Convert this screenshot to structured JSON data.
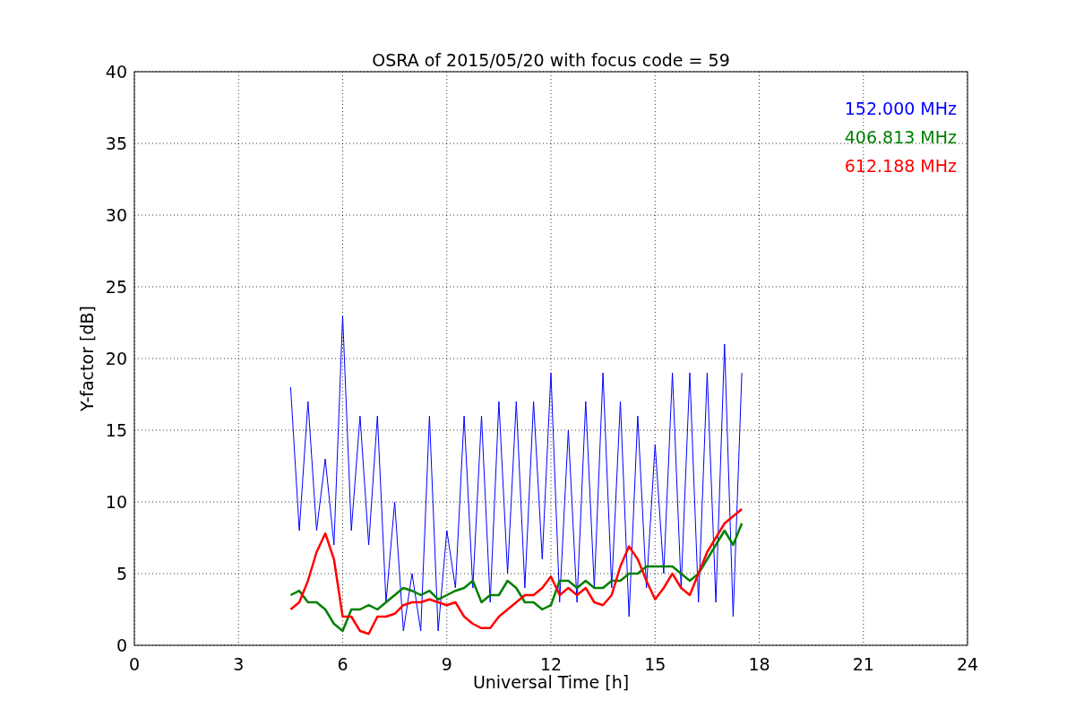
{
  "chart_data": {
    "type": "line",
    "title": "OSRA of 2015/05/20 with focus code = 59",
    "xlabel": "Universal Time [h]",
    "ylabel": "Y-factor [dB]",
    "x": [
      4.5,
      4.75,
      5,
      5.25,
      5.5,
      5.75,
      6,
      6.25,
      6.5,
      6.75,
      7,
      7.25,
      7.5,
      7.75,
      8,
      8.25,
      8.5,
      8.75,
      9,
      9.25,
      9.5,
      9.75,
      10,
      10.25,
      10.5,
      10.75,
      11,
      11.25,
      11.5,
      11.75,
      12,
      12.25,
      12.5,
      12.75,
      13,
      13.25,
      13.5,
      13.75,
      14,
      14.25,
      14.5,
      14.75,
      15,
      15.25,
      15.5,
      15.75,
      16,
      16.25,
      16.5,
      16.75,
      17,
      17.25,
      17.5
    ],
    "series": [
      {
        "name": "152.000 MHz",
        "color": "#0000ff",
        "values": [
          18,
          8,
          17,
          8,
          13,
          7,
          23,
          8,
          16,
          7,
          16,
          3,
          10,
          1,
          5,
          1,
          16,
          1,
          8,
          4,
          16,
          4,
          16,
          3,
          17,
          5,
          17,
          4,
          17,
          6,
          19,
          3,
          15,
          3,
          17,
          4,
          19,
          4,
          17,
          2,
          16,
          4,
          14,
          5,
          19,
          4,
          19,
          3,
          19,
          3,
          21,
          2,
          19
        ]
      },
      {
        "name": "406.813 MHz",
        "color": "#008000",
        "values": [
          3.5,
          3.8,
          3,
          3,
          2.5,
          1.5,
          1,
          2.5,
          2.5,
          2.8,
          2.5,
          3,
          3.5,
          4,
          3.8,
          3.5,
          3.8,
          3.2,
          3.5,
          3.8,
          4,
          4.5,
          3,
          3.5,
          3.5,
          4.5,
          4,
          3,
          3,
          2.5,
          2.8,
          4.5,
          4.5,
          4,
          4.5,
          4,
          4,
          4.5,
          4.5,
          5,
          5,
          5.5,
          5.5,
          5.5,
          5.5,
          5,
          4.5,
          5,
          6,
          7,
          8,
          7,
          8.5
        ]
      },
      {
        "name": "612.188 MHz",
        "color": "#ff0000",
        "values": [
          2.5,
          3,
          4.5,
          6.5,
          7.8,
          6,
          2,
          2,
          1,
          0.8,
          2,
          2,
          2.2,
          2.8,
          3,
          3,
          3.2,
          3,
          2.8,
          3,
          2,
          1.5,
          1.2,
          1.2,
          2,
          2.5,
          3,
          3.5,
          3.5,
          4,
          4.8,
          3.5,
          4,
          3.5,
          4,
          3,
          2.8,
          3.5,
          5.5,
          6.9,
          6,
          4.5,
          3.2,
          4,
          5,
          4,
          3.5,
          5,
          6.5,
          7.5,
          8.5,
          9,
          9.5
        ]
      }
    ],
    "grid": true,
    "xlim": [
      0,
      24
    ],
    "ylim": [
      0,
      40
    ],
    "xticks": [
      0,
      3,
      6,
      9,
      12,
      15,
      18,
      21,
      24
    ],
    "yticks": [
      0,
      5,
      10,
      15,
      20,
      25,
      30,
      35,
      40
    ]
  }
}
